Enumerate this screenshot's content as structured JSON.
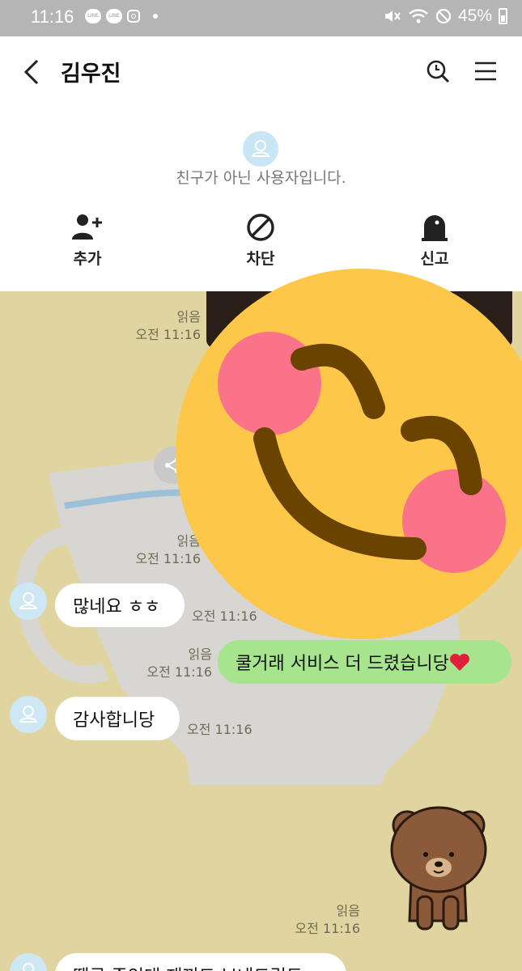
{
  "status_bar": {
    "time": "11:16",
    "line_label": "LINE",
    "battery": "45%"
  },
  "header": {
    "title": "김우진"
  },
  "notice": {
    "text": "친구가 아닌 사용자입니다.",
    "actions": [
      {
        "label": "추가"
      },
      {
        "label": "차단"
      },
      {
        "label": "신고"
      }
    ]
  },
  "messages": [
    {
      "read": "읽음",
      "time": "오전 11:16"
    },
    {
      "read": "읽음",
      "time": "오전 11:16"
    },
    {
      "text": "많네요 ㅎㅎ",
      "time": "오전 11:16"
    },
    {
      "read": "읽음",
      "time": "오전 11:16",
      "text": "쿨거래 서비스 더 드렸습니당"
    },
    {
      "text": "감사합니당",
      "time": "오전 11:16"
    },
    {
      "read": "읽음",
      "time": "오전 11:16"
    },
    {
      "text": "땡큐 쥬인대 재꺼드 보내드릴도"
    }
  ],
  "colors": {
    "chat_bg": "#e0d5a0",
    "sent_bubble": "#a6e48e",
    "avatar_bg": "#cde7f5",
    "status_bar": "#b5b5b5"
  },
  "icons": [
    "back-icon",
    "search-icon",
    "menu-icon",
    "add-friend-icon",
    "block-icon",
    "report-icon",
    "share-icon",
    "profile-icon",
    "heart-icon",
    "blushing-face-sticker",
    "bear-sticker"
  ]
}
